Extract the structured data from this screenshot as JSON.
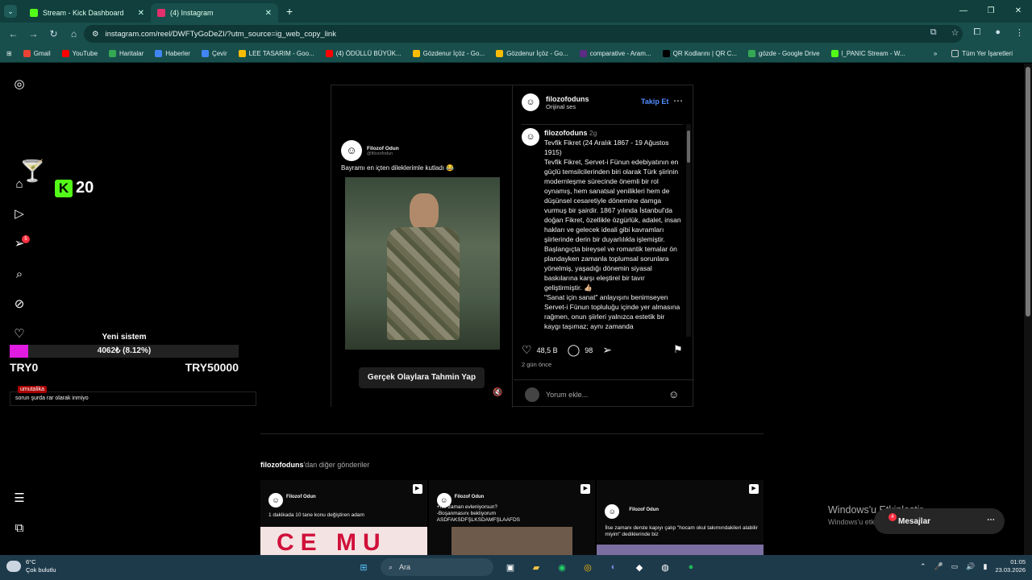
{
  "browser": {
    "tabs": [
      {
        "title": "Stream - Kick Dashboard",
        "color": "#53fc18",
        "active": false
      },
      {
        "title": "(4) Instagram",
        "color": "#e1306c",
        "active": true
      }
    ],
    "url": "instagram.com/reel/DWFTyGoDeZI/?utm_source=ig_web_copy_link",
    "bookmarks": [
      {
        "label": "Gmail",
        "color": "#ea4335"
      },
      {
        "label": "YouTube",
        "color": "#ff0000"
      },
      {
        "label": "Haritalar",
        "color": "#34a853"
      },
      {
        "label": "Haberler",
        "color": "#4285f4"
      },
      {
        "label": "Çevir",
        "color": "#4285f4"
      },
      {
        "label": "LEE TASARIM - Goo...",
        "color": "#fbbc04"
      },
      {
        "label": "(4) ÖDÜLLÜ BÜYÜK...",
        "color": "#ff0000"
      },
      {
        "label": "Gözdenur İçöz - Go...",
        "color": "#fbbc04"
      },
      {
        "label": "Gözdenur İçöz - Go...",
        "color": "#fbbc04"
      },
      {
        "label": "comparative - Aram...",
        "color": "#5b2c83"
      },
      {
        "label": "QR Kodlarını | QR C...",
        "color": "#000000"
      },
      {
        "label": "gözde - Google Drive",
        "color": "#34a853"
      },
      {
        "label": "l_PANIC Stream - W...",
        "color": "#53fc18"
      }
    ],
    "all_bookmarks": "Tüm Yer İşaretleri"
  },
  "overlay": {
    "kick_count": "20",
    "goal_title": "Yeni sistem",
    "goal_value": "4062₺ (8.12%)",
    "goal_progress": 8.12,
    "goal_start": "TRY0",
    "goal_end": "TRY50000",
    "chat_user": "umutalika",
    "chat_message": "sorun şurda rar olarak inmiyo"
  },
  "sidebar": {
    "notification_count": "5"
  },
  "reel": {
    "tweet_name": "Filozof Odun",
    "tweet_handle": "@filozofodun",
    "tweet_text": "Bayramı en içten dileklerimle kutladı 😂",
    "cta_label": "Gerçek Olaylara Tahmin Yap",
    "username": "filozofoduns",
    "audio": "Orijinal ses",
    "follow_label": "Takip Et",
    "caption_user": "filozofoduns",
    "caption_age": "2g",
    "caption": "Tevfik Fikret (24 Aralık 1867 - 19 Ağustos 1915)\nTevfik Fikret, Servet-i Fünun edebiyatının en güçlü temsilcilerinden biri olarak Türk şiirinin modernleşme sürecinde önemli bir rol oynamış, hem sanatsal yenilikleri hem de düşünsel cesaretiyle dönemine damga vurmuş bir şairdir. 1867 yılında İstanbul'da doğan Fikret, özellikle özgürlük, adalet, insan hakları ve gelecek ideali gibi kavramları şiirlerinde derin bir duyarlılıkla işlemiştir. Başlangıçta bireysel ve romantik temalar ön plandayken zamanla toplumsal sorunlara yönelmiş, yaşadığı dönemin siyasal baskılarına karşı eleştirel bir tavır geliştirmiştir. 👍🏼\n\"Sanat için sanat\" anlayışını benimseyen Servet-i Fünun topluluğu içinde yer almasına rağmen, onun şiirleri yalnızca estetik bir kaygı taşımaz; aynı zamanda",
    "likes": "48,5 B",
    "comments": "98",
    "time_ago": "2 gün önce",
    "comment_placeholder": "Yorum ekle..."
  },
  "more_posts": {
    "user": "filozofoduns",
    "suffix": "'dan diğer gönderiler",
    "items": [
      {
        "name": "Filozof Odun",
        "text": "1 dakikada 10 tane konu değiştiren adam",
        "image_text": "CE MU"
      },
      {
        "name": "Filozof Odun",
        "text": "+Ne zaman evleniyorsun?\n-Boşanmasını bekliyorum\nASDFAKSDFŞLKSDAMFŞLAAFDS",
        "image_text": ""
      },
      {
        "name": "Filozof Odun",
        "text": "İlse zamanı derste kapıyı çalıp \"hocam okul takımındakileri alabilir miyim\" dediklerinde biz",
        "image_text": ""
      }
    ]
  },
  "windows_activation": {
    "title": "Windows'u Etkinleştir",
    "subtitle": "Windows'u etk... Ayarlar..."
  },
  "messages": {
    "label": "Mesajlar",
    "badge": "4"
  },
  "taskbar": {
    "temp": "6°C",
    "weather": "Çok bulutlu",
    "search_placeholder": "Ara",
    "time": "01:05",
    "date": "23.03.2026"
  }
}
